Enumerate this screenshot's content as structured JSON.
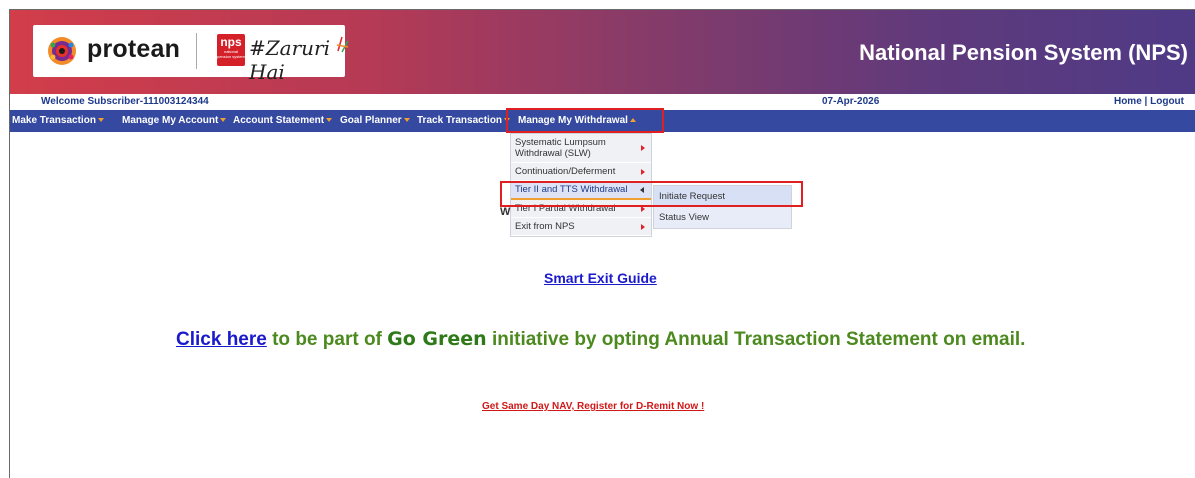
{
  "header": {
    "protean_logo_text": "protean",
    "nps_badge": "nps",
    "nps_badge_sub": "national pension system",
    "slogan": "#Zaruri Hai",
    "site_title": "National Pension System (NPS)"
  },
  "welcome_bar": {
    "welcome": "Welcome Subscriber-111003124344",
    "date": "07-Apr-2026",
    "home": "Home",
    "separator": " | ",
    "logout": "Logout"
  },
  "nav": {
    "items": [
      {
        "label": "Make Transaction"
      },
      {
        "label": "Manage My Account"
      },
      {
        "label": "Account Statement"
      },
      {
        "label": "Goal Planner"
      },
      {
        "label": "Track Transaction"
      },
      {
        "label": "Manage My Withdrawal"
      }
    ]
  },
  "dropdown": {
    "items": [
      {
        "label": "Systematic Lumpsum Withdrawal (SLW)"
      },
      {
        "label": "Continuation/Deferment"
      },
      {
        "label": "Tier II and TTS Withdrawal"
      },
      {
        "label": "Tier I Partial Withdrawal"
      },
      {
        "label": "Exit from NPS"
      }
    ],
    "submenu": [
      {
        "label": "Initiate Request"
      },
      {
        "label": "Status View"
      }
    ]
  },
  "main": {
    "hidden_fragment": "W",
    "smart_exit": "Smart Exit Guide",
    "go_green_link": "Click here",
    "go_green_pre": " to be part of ",
    "go_green_bold": "Go Green",
    "go_green_post": " initiative by opting Annual Transaction Statement on email.",
    "dremit": "Get Same Day NAV, Register for D-Remit Now !"
  },
  "colors": {
    "nav_bg": "#3549a0",
    "highlight": "#e02020",
    "link": "#1a1acc",
    "go_green": "#4c8a1f"
  }
}
